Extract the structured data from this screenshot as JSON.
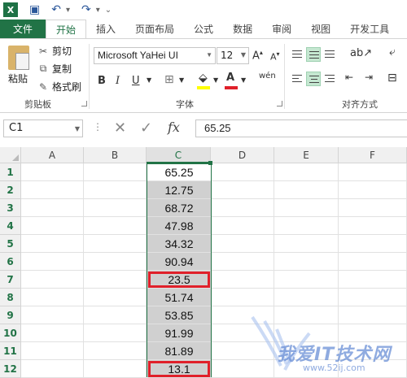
{
  "quick_access": {
    "app_icon": "X",
    "icons": [
      "save-icon",
      "undo-icon",
      "redo-icon"
    ]
  },
  "tabs": [
    "文件",
    "开始",
    "插入",
    "页面布局",
    "公式",
    "数据",
    "审阅",
    "视图",
    "开发工具"
  ],
  "active_tab": "开始",
  "ribbon": {
    "clipboard": {
      "paste": "粘贴",
      "cut": "剪切",
      "copy": "复制",
      "format_painter": "格式刷",
      "label": "剪贴板"
    },
    "font": {
      "name": "Microsoft YaHei UI",
      "size": "12",
      "bold": "B",
      "italic": "I",
      "underline": "U",
      "label": "字体",
      "grow": "A",
      "shrink": "A",
      "phonetic": "wén"
    },
    "alignment": {
      "label": "对齐方式"
    }
  },
  "formula_bar": {
    "name_box": "C1",
    "cancel": "✕",
    "enter": "✓",
    "fx": "fx",
    "value": "65.25"
  },
  "columns": [
    "A",
    "B",
    "C",
    "D",
    "E",
    "F"
  ],
  "selected_column": "C",
  "rows": [
    "1",
    "2",
    "3",
    "4",
    "5",
    "6",
    "7",
    "8",
    "9",
    "10",
    "11",
    "12"
  ],
  "column_c_values": [
    "65.25",
    "12.75",
    "68.72",
    "47.98",
    "34.32",
    "90.94",
    "23.5",
    "51.74",
    "53.85",
    "91.99",
    "81.89",
    "13.1"
  ],
  "red_boxed_rows": [
    7,
    12
  ],
  "colors": {
    "accent": "#217346",
    "highlight": "#d0d0d0",
    "red_box": "#e0202a"
  },
  "watermark": {
    "text": "我爱IT技术网",
    "url": "www.52ij.com"
  }
}
